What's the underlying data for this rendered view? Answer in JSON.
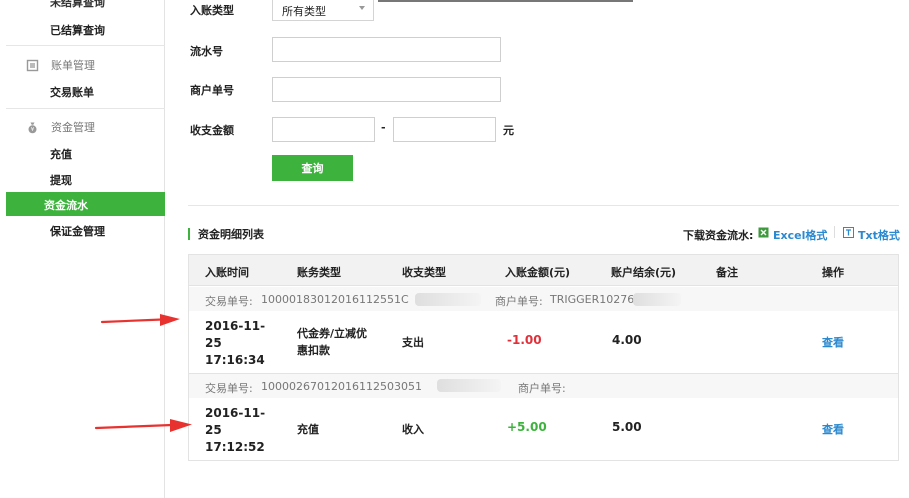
{
  "sidebar": {
    "cut_item": "未结算查询",
    "settled_query": "已结算查询",
    "bill_group": "账单管理",
    "trade_bill": "交易账单",
    "fund_group": "资金管理",
    "recharge": "充值",
    "withdraw": "提现",
    "fund_flow": "资金流水",
    "deposit": "保证金管理"
  },
  "form": {
    "type_label": "入账类型",
    "type_value": "所有类型",
    "serial_label": "流水号",
    "merchant_no_label": "商户单号",
    "amount_label": "收支金额",
    "range_dash": "-",
    "unit": "元",
    "query_button": "查询"
  },
  "section": {
    "title": "资金明细列表",
    "download_label": "下载资金流水:",
    "excel": "Excel格式",
    "txt": "Txt格式"
  },
  "table": {
    "headers": [
      "入账时间",
      "账务类型",
      "收支类型",
      "入账金额(元)",
      "账户结余(元)",
      "备注",
      "操作"
    ],
    "rows": [
      {
        "trade_no_label": "交易单号:",
        "trade_no": "10000183012016112551C",
        "merchant_no_label": "商户单号:",
        "merchant_no": "TRIGGER10276",
        "time": "2016-11-25 17:16:34",
        "type": "代金券/立减优惠扣款",
        "type_line1": "代金券/立减优",
        "type_line2": "惠扣款",
        "io": "支出",
        "amount": "-1.00",
        "balance": "4.00",
        "remark": "",
        "action": "查看"
      },
      {
        "trade_no_label": "交易单号:",
        "trade_no": "10000267012016112503051",
        "merchant_no_label": "商户单号:",
        "merchant_no": "",
        "time": "2016-11-25 17:12:52",
        "type": "充值",
        "io": "收入",
        "amount": "+5.00",
        "balance": "5.00",
        "remark": "",
        "action": "查看"
      }
    ]
  },
  "colors": {
    "accent_green": "#3db33d",
    "link_blue": "#2b89cf",
    "negative_red": "#e0303a",
    "arrow_red": "#e8322f"
  }
}
